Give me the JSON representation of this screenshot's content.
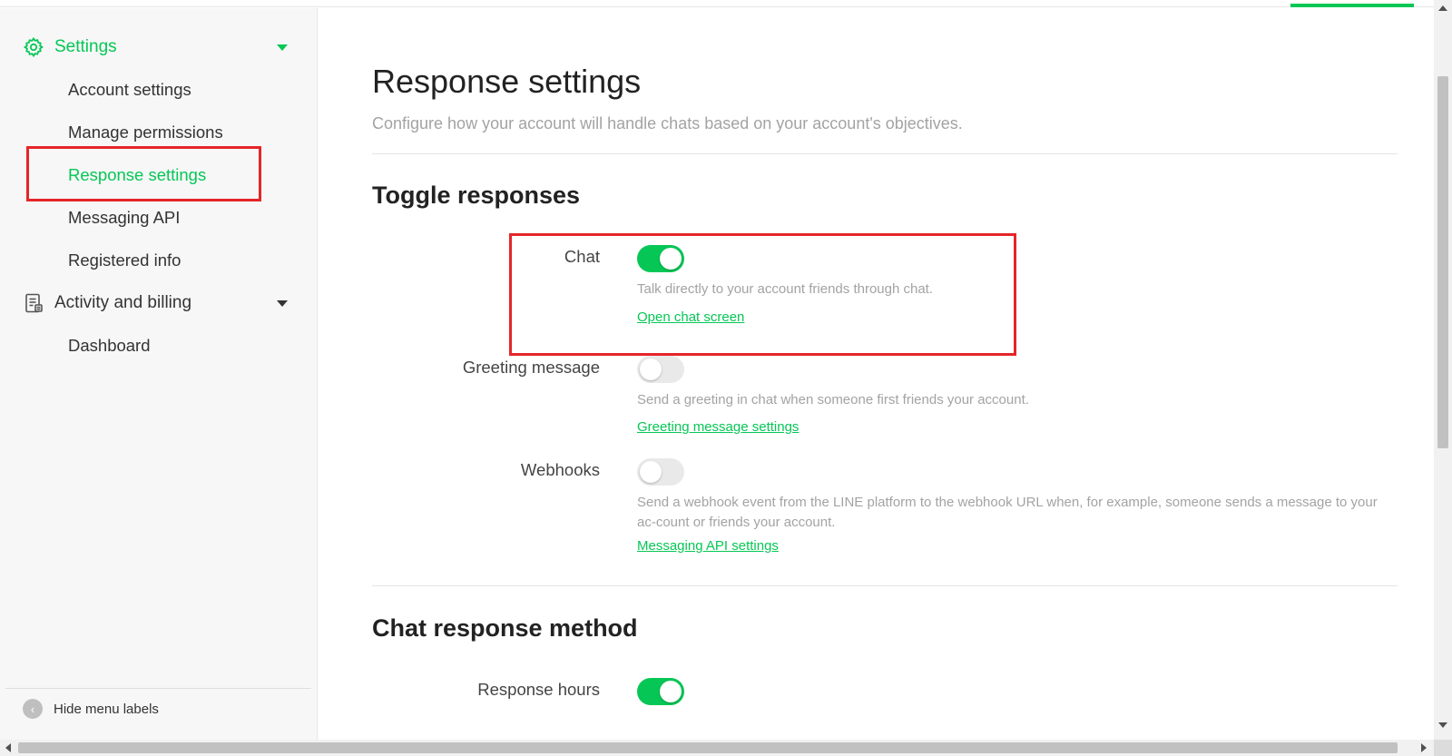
{
  "colors": {
    "brand_green": "#06c755",
    "annotation_red": "#e5252a",
    "muted_text": "#a3a3a3"
  },
  "sidebar": {
    "groups": [
      {
        "label": "Settings",
        "icon": "gear-icon",
        "expanded": true
      },
      {
        "label": "Activity and billing",
        "icon": "document-icon",
        "expanded": true
      }
    ],
    "settings_items": [
      {
        "label": "Account settings"
      },
      {
        "label": "Manage permissions"
      },
      {
        "label": "Response settings",
        "active": true
      },
      {
        "label": "Messaging API"
      },
      {
        "label": "Registered info"
      }
    ],
    "billing_items": [
      {
        "label": "Dashboard"
      }
    ],
    "hide_labels": "Hide menu labels"
  },
  "main": {
    "title": "Response settings",
    "subtitle": "Configure how your account will handle chats based on your account's objectives.",
    "sections": [
      {
        "title": "Toggle responses",
        "rows": [
          {
            "label": "Chat",
            "on": true,
            "description": "Talk directly to your account friends through chat.",
            "link": "Open chat screen"
          },
          {
            "label": "Greeting message",
            "on": false,
            "description": "Send a greeting in chat when someone first friends your account.",
            "link": "Greeting message settings"
          },
          {
            "label": "Webhooks",
            "on": false,
            "description": "Send a webhook event from the LINE platform to the webhook URL when, for example, someone sends a message to your ac-count or friends your account.",
            "link": "Messaging API settings"
          }
        ]
      },
      {
        "title": "Chat response method",
        "rows": [
          {
            "label": "Response hours",
            "on": true
          }
        ]
      }
    ]
  }
}
